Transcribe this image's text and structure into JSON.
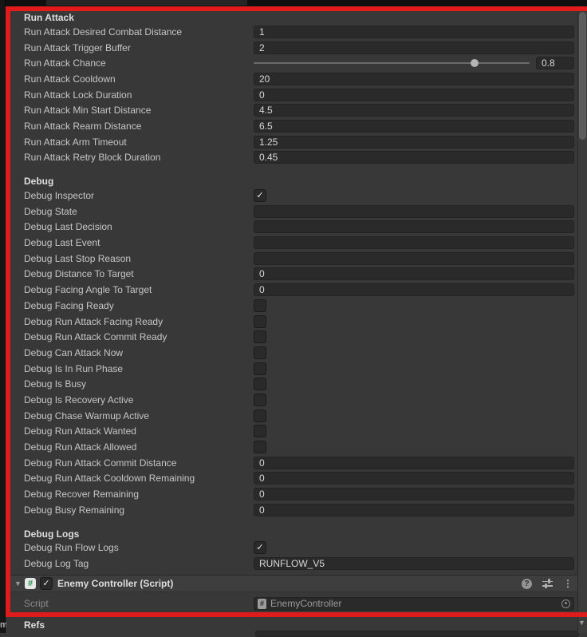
{
  "colors": {
    "highlight_red": "#e01b1b",
    "panel_bg": "#383838",
    "field_bg": "#2a2a2a",
    "header_bg": "#3e3e3e"
  },
  "icons": {
    "check": "✓",
    "foldout": "▼",
    "help": "?",
    "menu": "⋮",
    "script_hash": "#",
    "down_arrow": "▼",
    "behind_text": "m"
  },
  "inspector": {
    "sections": [
      {
        "header": "Run Attack",
        "rows": [
          {
            "label": "Run Attack Desired Combat Distance",
            "type": "text",
            "value": "1"
          },
          {
            "label": "Run Attack Trigger Buffer",
            "type": "text",
            "value": "2"
          },
          {
            "label": "Run Attack Chance",
            "type": "slider",
            "value": "0.8",
            "fraction": 0.8
          },
          {
            "label": "Run Attack Cooldown",
            "type": "text",
            "value": "20"
          },
          {
            "label": "Run Attack Lock Duration",
            "type": "text",
            "value": "0"
          },
          {
            "label": "Run Attack Min Start Distance",
            "type": "text",
            "value": "4.5"
          },
          {
            "label": "Run Attack Rearm Distance",
            "type": "text",
            "value": "6.5"
          },
          {
            "label": "Run Attack Arm Timeout",
            "type": "text",
            "value": "1.25"
          },
          {
            "label": "Run Attack Retry Block Duration",
            "type": "text",
            "value": "0.45"
          }
        ]
      },
      {
        "header": "Debug",
        "rows": [
          {
            "label": "Debug Inspector",
            "type": "checkbox",
            "checked": true
          },
          {
            "label": "Debug State",
            "type": "text",
            "value": ""
          },
          {
            "label": "Debug Last Decision",
            "type": "text",
            "value": ""
          },
          {
            "label": "Debug Last Event",
            "type": "text",
            "value": ""
          },
          {
            "label": "Debug Last Stop Reason",
            "type": "text",
            "value": ""
          },
          {
            "label": "Debug Distance To Target",
            "type": "text",
            "value": "0"
          },
          {
            "label": "Debug Facing Angle To Target",
            "type": "text",
            "value": "0"
          },
          {
            "label": "Debug Facing Ready",
            "type": "checkbox",
            "checked": false
          },
          {
            "label": "Debug Run Attack Facing Ready",
            "type": "checkbox",
            "checked": false
          },
          {
            "label": "Debug Run Attack Commit Ready",
            "type": "checkbox",
            "checked": false
          },
          {
            "label": "Debug Can Attack Now",
            "type": "checkbox",
            "checked": false
          },
          {
            "label": "Debug Is In Run Phase",
            "type": "checkbox",
            "checked": false
          },
          {
            "label": "Debug Is Busy",
            "type": "checkbox",
            "checked": false
          },
          {
            "label": "Debug Is Recovery Active",
            "type": "checkbox",
            "checked": false
          },
          {
            "label": "Debug Chase Warmup Active",
            "type": "checkbox",
            "checked": false
          },
          {
            "label": "Debug Run Attack Wanted",
            "type": "checkbox",
            "checked": false
          },
          {
            "label": "Debug Run Attack Allowed",
            "type": "checkbox",
            "checked": false
          },
          {
            "label": "Debug Run Attack Commit Distance",
            "type": "text",
            "value": "0"
          },
          {
            "label": "Debug Run Attack Cooldown Remaining",
            "type": "text",
            "value": "0"
          },
          {
            "label": "Debug Recover Remaining",
            "type": "text",
            "value": "0"
          },
          {
            "label": "Debug Busy Remaining",
            "type": "text",
            "value": "0"
          }
        ]
      },
      {
        "header": "Debug Logs",
        "rows": [
          {
            "label": "Debug Run Flow Logs",
            "type": "checkbox",
            "checked": true
          },
          {
            "label": "Debug Log Tag",
            "type": "text",
            "value": "RUNFLOW_V5"
          }
        ]
      }
    ],
    "component": {
      "title": "Enemy Controller (Script)",
      "enabled": true
    },
    "script_row": {
      "label": "Script",
      "value": "EnemyController"
    },
    "refs_header": "Refs"
  }
}
